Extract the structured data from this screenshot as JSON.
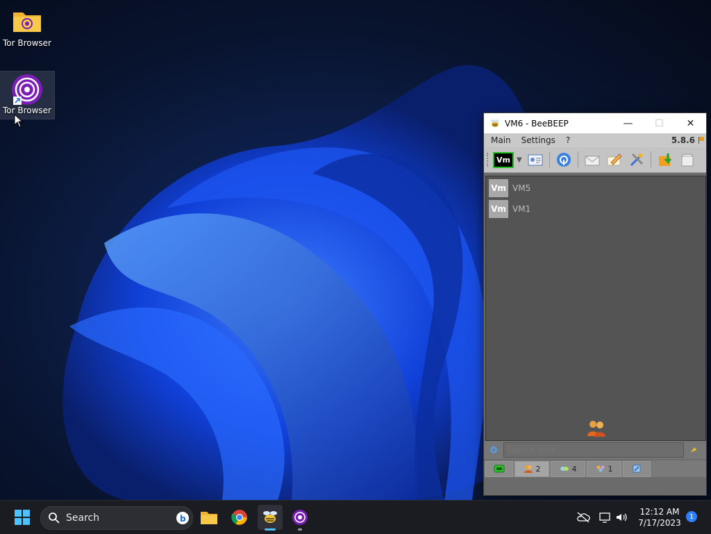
{
  "desktop": {
    "icons": [
      {
        "label": "Tor Browser",
        "type": "folder"
      },
      {
        "label": "Tor Browser",
        "type": "shortcut"
      }
    ]
  },
  "window": {
    "title": "VM6 - BeeBEEP",
    "menu": [
      "Main",
      "Settings",
      "?"
    ],
    "version": "5.8.6",
    "status_badge": "Vm",
    "users": [
      {
        "badge": "Vm",
        "name": "VM5"
      },
      {
        "badge": "Vm",
        "name": "VM1"
      }
    ],
    "search": {
      "placeholder": "Search user"
    },
    "tabs": [
      {
        "icon": "chat-icon",
        "count": ""
      },
      {
        "icon": "users-icon",
        "count": "2"
      },
      {
        "icon": "pills-icon",
        "count": "4"
      },
      {
        "icon": "groups-icon",
        "count": "1"
      },
      {
        "icon": "log-icon",
        "count": ""
      }
    ]
  },
  "taskbar": {
    "search_label": "Search",
    "time": "12:12 AM",
    "date": "7/17/2023",
    "notifications": "1"
  },
  "colors": {
    "accent": "#2f80ff",
    "tor_purple": "#7a1fb5",
    "window_bg": "#6b6b6b"
  }
}
